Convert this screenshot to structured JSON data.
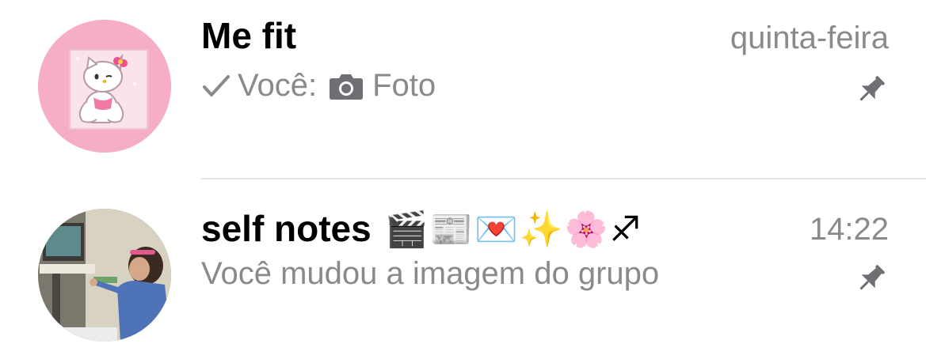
{
  "chats": [
    {
      "name": "Me fit",
      "time": "quinta-feira",
      "preview_sender": "Você:",
      "preview_text": "Foto",
      "preview_icons": [
        "read-check-icon",
        "camera-icon"
      ],
      "pinned": true
    },
    {
      "name": "self notes",
      "name_emoji": "🎬📰💌✨🌸♐",
      "time": "14:22",
      "preview_text": "Você mudou a imagem do grupo",
      "pinned": true
    }
  ],
  "colors": {
    "primary_text": "#000000",
    "secondary_text": "#8a8a8e",
    "pin_icon": "#6e6e73",
    "separator": "#e4e4e6",
    "avatar_1_bg": "#f6aec4"
  }
}
